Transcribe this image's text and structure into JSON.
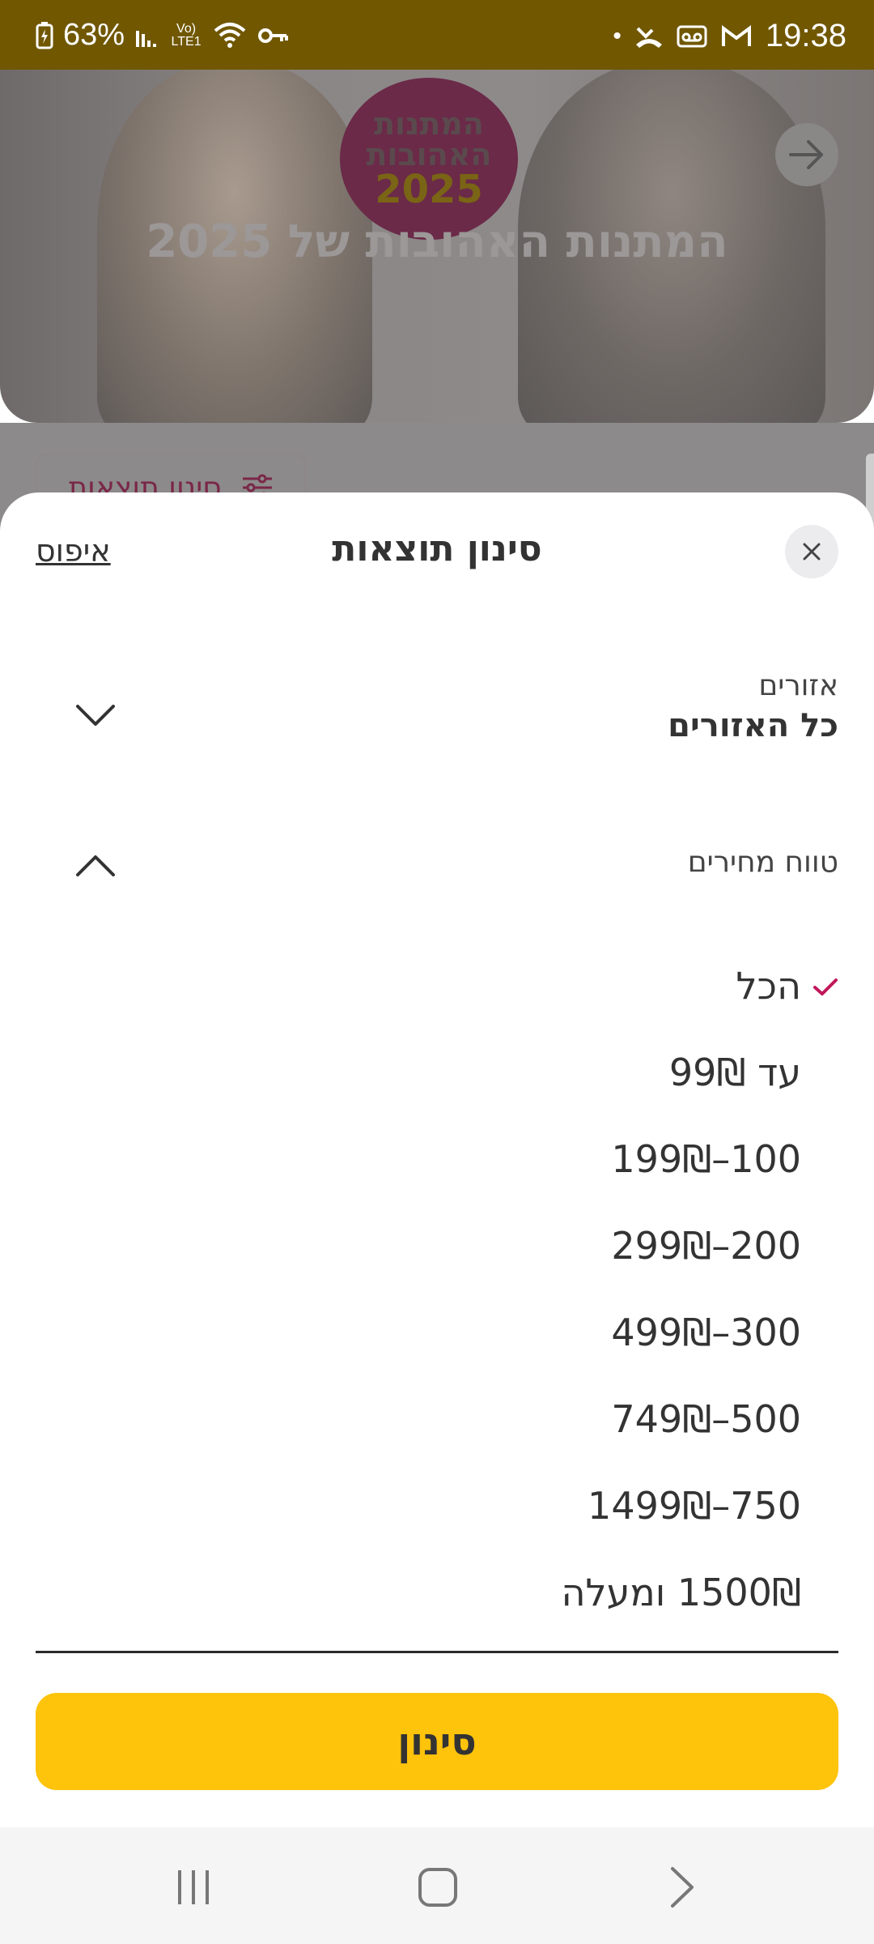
{
  "status_bar": {
    "battery": "63%",
    "network": "Vo) LTE1",
    "time": "19:38",
    "icons_left": [
      "battery-charging-icon",
      "signal-icon",
      "volte-icon",
      "wifi-icon",
      "vpn-key-icon"
    ],
    "icons_right": [
      "dot-icon",
      "missed-call-icon",
      "voicemail-icon",
      "gmail-icon"
    ]
  },
  "hero": {
    "badge_line1": "המתנות",
    "badge_line2": "האהובות",
    "badge_year": "2025",
    "title": "המתנות האהובות של 2025"
  },
  "page": {
    "filter_chip_label": "סינון תוצאות"
  },
  "sheet": {
    "title": "סינון תוצאות",
    "reset_label": "איפוס",
    "regions": {
      "label": "אזורים",
      "value": "כל האזורים"
    },
    "price_range": {
      "label": "טווח מחירים",
      "selected": "הכל",
      "options": [
        "הכל",
        "עד 99₪",
        "100–199₪",
        "200–299₪",
        "300–499₪",
        "500–749₪",
        "750–1499₪",
        "1500₪ ומעלה"
      ]
    },
    "submit_label": "סינון"
  },
  "colors": {
    "status_bar": "#705700",
    "accent_yellow": "#fec30b",
    "check_pink": "#c2185b"
  }
}
